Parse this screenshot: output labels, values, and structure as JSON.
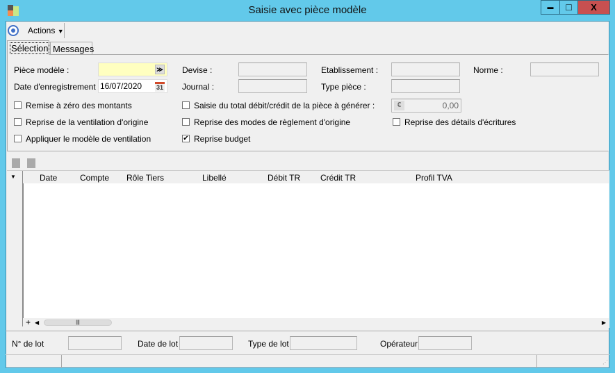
{
  "window": {
    "title": "Saisie avec pièce modèle",
    "minimize": "▬",
    "maximize": "□",
    "close": "X"
  },
  "toolbar": {
    "actions_label": "Actions"
  },
  "tabs": [
    {
      "label": "Sélection"
    },
    {
      "label": "Messages"
    }
  ],
  "form": {
    "piece_modele_label": "Pièce modèle :",
    "piece_modele_value": "",
    "date_label": "Date d'enregistrement :",
    "date_value": "16/07/2020",
    "calendar_day": "31",
    "devise_label": "Devise :",
    "journal_label": "Journal :",
    "etablissement_label": "Etablissement :",
    "type_piece_label": "Type pièce :",
    "norme_label": "Norme :",
    "montant_value": "0,00",
    "currency_symbol": "€",
    "checkboxes": [
      {
        "label": "Remise à zéro des montants",
        "checked": false
      },
      {
        "label": "Reprise de la ventilation d'origine",
        "checked": false
      },
      {
        "label": "Appliquer le modèle de ventilation",
        "checked": false
      },
      {
        "label": "Saisie du total débit/crédit de la pièce à générer :",
        "checked": false
      },
      {
        "label": "Reprise des modes de règlement d'origine",
        "checked": false
      },
      {
        "label": "Reprise budget",
        "checked": true
      },
      {
        "label": "Reprise des détails d'écritures",
        "checked": false
      }
    ]
  },
  "grid": {
    "columns": [
      "Date",
      "Compte",
      "Rôle Tiers",
      "Libellé",
      "Débit TR",
      "Crédit TR",
      "Profil TVA"
    ],
    "add": "+"
  },
  "footer": {
    "lot_label": "N° de lot",
    "date_lot_label": "Date de lot",
    "type_lot_label": "Type de lot",
    "operateur_label": "Opérateur"
  }
}
